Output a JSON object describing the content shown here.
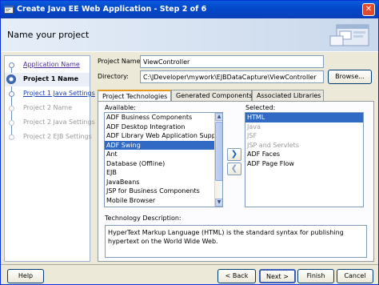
{
  "window": {
    "title": "Create Java EE Web Application - Step 2 of 6"
  },
  "header": {
    "title": "Name your project"
  },
  "steps": [
    {
      "label": "Application Name",
      "state": "link"
    },
    {
      "label": "Project 1 Name",
      "state": "current"
    },
    {
      "label": "Project 1 Java Settings",
      "state": "nextlink"
    },
    {
      "label": "Project 2 Name",
      "state": "disabled"
    },
    {
      "label": "Project 2 Java Settings",
      "state": "disabled"
    },
    {
      "label": "Project 2 EJB Settings",
      "state": "disabled"
    }
  ],
  "form": {
    "project_name_label": "Project Name:",
    "project_name_value": "ViewController",
    "directory_label": "Directory:",
    "directory_value": "C:\\JDeveloper\\mywork\\EJBDataCapture\\ViewController",
    "browse_label": "Browse..."
  },
  "tabs": [
    {
      "label": "Project Technologies",
      "active": true
    },
    {
      "label": "Generated Components",
      "active": false
    },
    {
      "label": "Associated Libraries",
      "active": false
    }
  ],
  "available": {
    "label": "Available:",
    "items": [
      "ADF Business Components",
      "ADF Desktop Integration",
      "ADF Library Web Application Support",
      "ADF Swing",
      "Ant",
      "Database (Offline)",
      "EJB",
      "JavaBeans",
      "JSP for Business Components",
      "Mobile Browser"
    ],
    "selected_index": 3
  },
  "selected": {
    "label": "Selected:",
    "items": [
      {
        "text": "HTML",
        "state": "selected"
      },
      {
        "text": "Java",
        "state": "dim"
      },
      {
        "text": "JSF",
        "state": "dim"
      },
      {
        "text": "JSP and Servlets",
        "state": "dim"
      },
      {
        "text": "ADF Faces",
        "state": "normal"
      },
      {
        "text": "ADF Page Flow",
        "state": "normal"
      }
    ]
  },
  "move": {
    "add_icon": "arrow-right-icon",
    "remove_icon": "arrow-left-icon"
  },
  "description": {
    "label": "Technology Description:",
    "text": "HyperText Markup Language (HTML) is the standard syntax for publishing hypertext on the World Wide Web."
  },
  "buttons": {
    "help": "Help",
    "back": "< Back",
    "next": "Next >",
    "finish": "Finish",
    "cancel": "Cancel"
  }
}
